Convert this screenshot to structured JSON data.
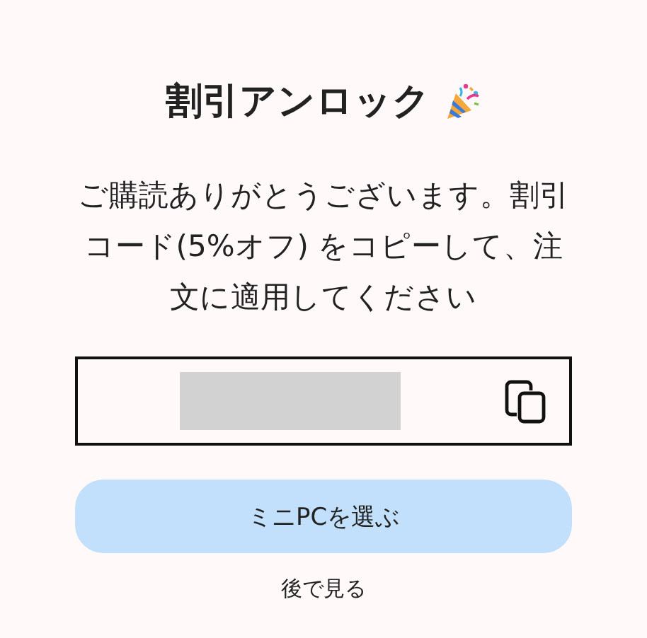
{
  "title": "割引アンロック",
  "message": "ご購読ありがとうございます。割引コード(5%オフ) をコピーして、注文に適用してください",
  "code_field": {
    "kind": "hidden"
  },
  "primary_button": "ミニPCを選ぶ",
  "secondary_link": "後で見る"
}
